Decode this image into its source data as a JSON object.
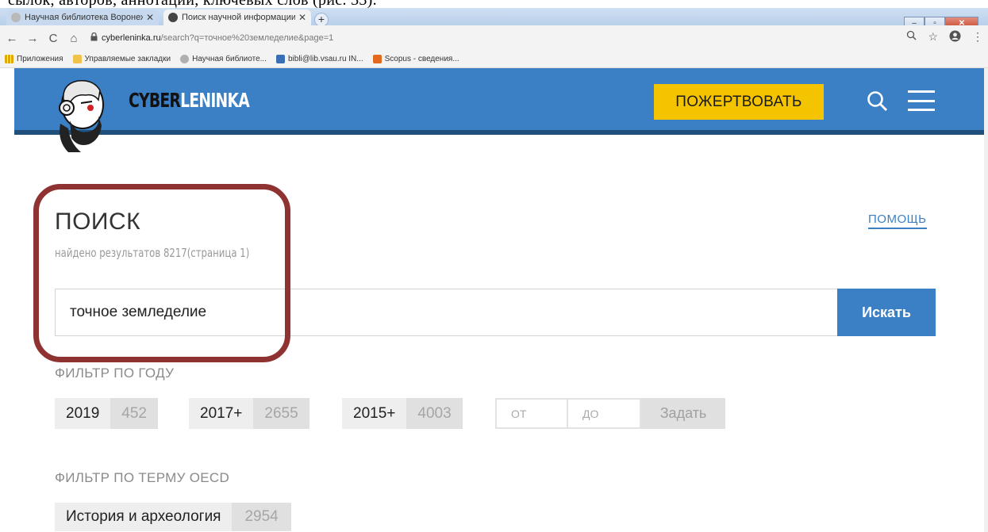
{
  "doc_sliver_text": "сылок, авторов, аннотаций, ключевых слов (рис. 33).",
  "tabs": [
    {
      "title": "Научная библиотека Воронеж…",
      "close": "✕"
    },
    {
      "title": "Поиск научной информации в…",
      "close": "✕"
    }
  ],
  "new_tab": "+",
  "window_controls": {
    "minimize": "–",
    "maximize": "▫",
    "close": "✕"
  },
  "nav": {
    "back": "←",
    "forward": "→",
    "reload": "C",
    "home": "⌂"
  },
  "address": {
    "host": "cyberleninka.ru",
    "path": "/search?q=точное%20земледелие&page=1"
  },
  "bookmarks": [
    {
      "label": "Приложения",
      "color": "#e0a800"
    },
    {
      "label": "Управляемые закладки",
      "color": "#f0c24a"
    },
    {
      "label": "Научная библиоте...",
      "color": "#b0b0b0"
    },
    {
      "label": "bibli@lib.vsau.ru IN...",
      "color": "#3a6fb5"
    },
    {
      "label": "Scopus - сведения...",
      "color": "#e26a1f"
    }
  ],
  "header": {
    "logo_cyber": "CYBER",
    "logo_leninka": "LENINKA",
    "donate_label": "ПОЖЕРТВОВАТЬ",
    "accent_color": "#3b7fc4",
    "donate_color": "#f5c400"
  },
  "search": {
    "title": "ПОИСК",
    "results_text": "найдено результатов 8217(страница 1)",
    "help_label": "ПОМОЩЬ",
    "query": "точное земледелие",
    "button_label": "Искать"
  },
  "year_filter": {
    "title": "ФИЛЬТР ПО ГОДУ",
    "options": [
      {
        "label": "2019",
        "count": "452"
      },
      {
        "label": "2017+",
        "count": "2655"
      },
      {
        "label": "2015+",
        "count": "4003"
      }
    ],
    "from_placeholder": "ОТ",
    "to_placeholder": "ДО",
    "set_label": "Задать"
  },
  "oecd_filter": {
    "title": "ФИЛЬТР ПО ТЕРМУ OECD",
    "options": [
      {
        "label": "История и археология",
        "count": "2954"
      }
    ]
  }
}
